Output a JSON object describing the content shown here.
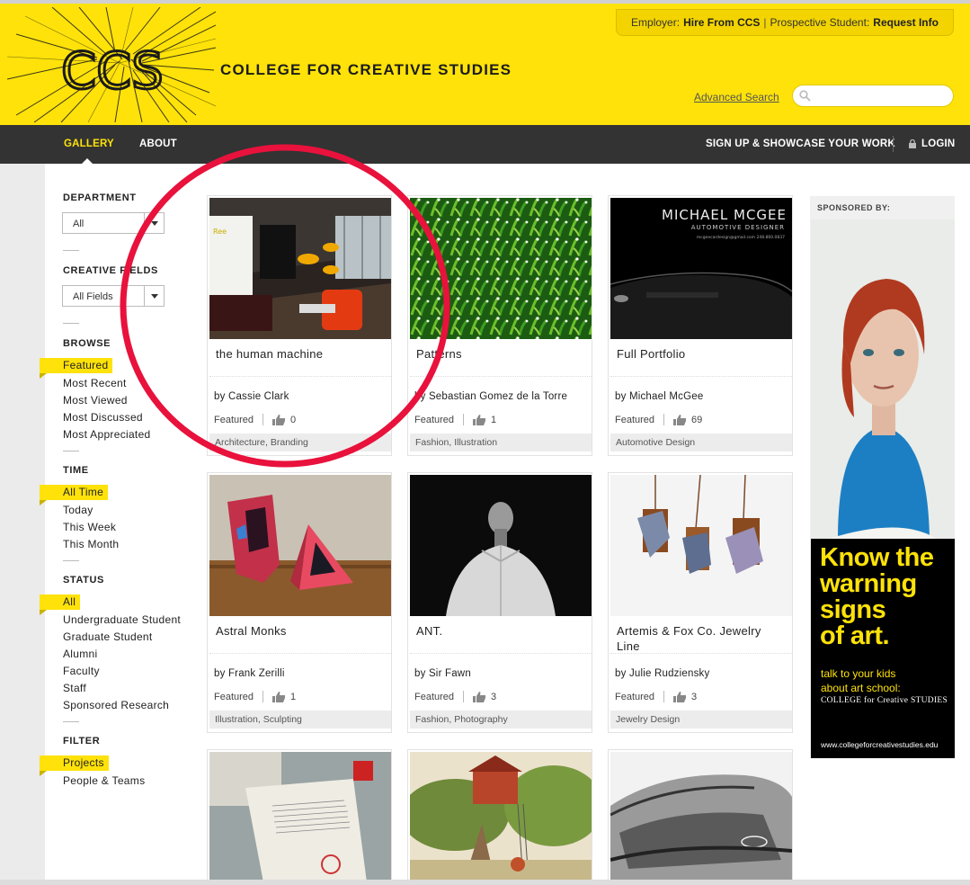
{
  "header": {
    "logo_text": "CCS",
    "college_name": "COLLEGE FOR CREATIVE STUDIES",
    "employer_label": "Employer:",
    "employer_link": "Hire From CCS",
    "divider": "|",
    "student_label": "Prospective Student:",
    "student_link": "Request Info",
    "advanced_search": "Advanced Search",
    "search_placeholder": "",
    "search_value": ""
  },
  "nav": {
    "gallery": "GALLERY",
    "about": "ABOUT",
    "signup": "SIGN UP & SHOWCASE YOUR WORK",
    "login": "LOGIN"
  },
  "sidebar": {
    "department": {
      "heading": "DEPARTMENT",
      "selected": "All"
    },
    "creative_fields": {
      "heading": "CREATIVE FIELDS",
      "selected": "All Fields"
    },
    "browse": {
      "heading": "BROWSE",
      "items": [
        "Featured",
        "Most Recent",
        "Most Viewed",
        "Most Discussed",
        "Most Appreciated"
      ],
      "active": 0
    },
    "time": {
      "heading": "TIME",
      "items": [
        "All Time",
        "Today",
        "This Week",
        "This Month"
      ],
      "active": 0
    },
    "status": {
      "heading": "STATUS",
      "items": [
        "All",
        "Undergraduate Student",
        "Graduate Student",
        "Alumni",
        "Faculty",
        "Staff",
        "Sponsored Research"
      ],
      "active": 0
    },
    "filter": {
      "heading": "FILTER",
      "items": [
        "Projects",
        "People & Teams"
      ],
      "active": 0
    }
  },
  "projects": [
    {
      "title": "the human machine",
      "author": "by Cassie Clark",
      "status": "Featured",
      "appreciations": "0",
      "tags": "Architecture, Branding"
    },
    {
      "title": "Patterns",
      "author": "by Sebastian Gomez de la Torre",
      "status": "Featured",
      "appreciations": "1",
      "tags": "Fashion, Illustration"
    },
    {
      "title": "Full Portfolio",
      "author": "by Michael McGee",
      "status": "Featured",
      "appreciations": "69",
      "tags": "Automotive Design"
    },
    {
      "title": "Astral Monks",
      "author": "by Frank Zerilli",
      "status": "Featured",
      "appreciations": "1",
      "tags": "Illustration, Sculpting"
    },
    {
      "title": "ANT.",
      "author": "by Sir Fawn",
      "status": "Featured",
      "appreciations": "3",
      "tags": "Fashion, Photography"
    },
    {
      "title": "Artemis & Fox Co. Jewelry Line",
      "author": "by Julie Rudziensky",
      "status": "Featured",
      "appreciations": "3",
      "tags": "Jewelry Design"
    }
  ],
  "thumb_text": {
    "mcgee_name": "MICHAEL MCGEE",
    "mcgee_role": "AUTOMOTIVE DESIGNER",
    "mcgee_contact": "mcgeecardesign@gmail.com  248.860.0837"
  },
  "sponsor": {
    "heading": "SPONSORED BY:",
    "headline_lines": [
      "Know the",
      "warning",
      "signs",
      "of art."
    ],
    "sub_lines": [
      "talk to your kids",
      "about art school:"
    ],
    "ccs_line": "COLLEGE for Creative STUDIES",
    "url": "www.collegeforcreativestudies.edu"
  },
  "colors": {
    "brand_yellow": "#fee209",
    "nav_dark": "#333333",
    "annotation_red": "#e8123c"
  }
}
